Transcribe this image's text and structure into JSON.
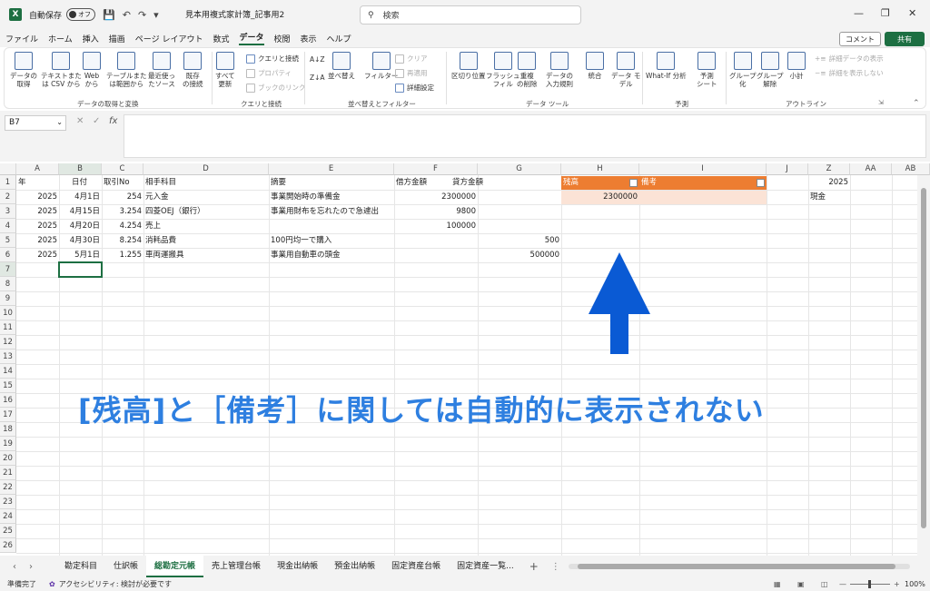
{
  "titlebar": {
    "autosave_label": "自動保存",
    "autosave_state": "オフ",
    "doc_title": "見本用複式家計簿_記事用2",
    "search_placeholder": "検索"
  },
  "menu": [
    "ファイル",
    "ホーム",
    "挿入",
    "描画",
    "ページ レイアウト",
    "数式",
    "データ",
    "校閲",
    "表示",
    "ヘルプ"
  ],
  "active_menu": "データ",
  "comment_label": "コメント",
  "share_label": "共有",
  "ribbon": {
    "get_data": "データの\n取得",
    "text_csv": "テキストまた\nは CSV から",
    "web": "Web\nから",
    "table_range": "テーブルまた\nは範囲から",
    "recent": "最近使っ\nたソース",
    "existing": "既存\nの接続",
    "group1": "データの取得と変換",
    "refresh_all": "すべて\n更新",
    "queries": "クエリと接続",
    "properties": "プロパティ",
    "book_links": "ブックのリンク",
    "group2": "クエリと接続",
    "sort": "並べ替え",
    "filter": "フィルター",
    "clear": "クリア",
    "reapply": "再適用",
    "advanced": "詳細設定",
    "group3": "並べ替えとフィルター",
    "text_to_col": "区切り位置",
    "flash_fill": "フラッシュ\nフィル",
    "remove_dup": "重複\nの削除",
    "validation": "データの\n入力規則",
    "consolidate": "統合",
    "data_model": "データ モ\nデル",
    "group4": "データ ツール",
    "whatif": "What-If 分析",
    "forecast": "予測\nシート",
    "group5": "予測",
    "group_btn": "グループ\n化",
    "ungroup": "グループ\n解除",
    "subtotal": "小計",
    "show_detail": "詳細データの表示",
    "hide_detail": "詳細を表示しない",
    "group6": "アウトライン"
  },
  "namebox": "B7",
  "fx": "fx",
  "columns": [
    "A",
    "B",
    "C",
    "D",
    "E",
    "F",
    "G",
    "H",
    "I",
    "J",
    "Z",
    "AA",
    "AB"
  ],
  "rows": [
    "1",
    "2",
    "3",
    "4",
    "5",
    "6",
    "7",
    "8",
    "9",
    "10",
    "11",
    "12",
    "13",
    "14",
    "15",
    "16",
    "17",
    "18",
    "19",
    "20",
    "21",
    "22",
    "23",
    "24",
    "25",
    "26"
  ],
  "headers": {
    "year": "年",
    "date": "日付",
    "txn_no": "取引No",
    "account": "相手科目",
    "summary": "摘要",
    "debit": "借方金額",
    "credit": "貸方金額",
    "balance": "残高",
    "note": "備考"
  },
  "table_rows": [
    {
      "year": "2025",
      "date": "4月1日",
      "no": "254",
      "account": "元入金",
      "summary": "事業開始時の準備金",
      "debit": "2300000",
      "credit": ""
    },
    {
      "year": "2025",
      "date": "4月15日",
      "no": "3.254",
      "account": "四菱OEJ（銀行）",
      "summary": "事業用財布を忘れたので急遽出",
      "debit": "9800",
      "credit": ""
    },
    {
      "year": "2025",
      "date": "4月20日",
      "no": "4.254",
      "account": "売上",
      "summary": "",
      "debit": "100000",
      "credit": ""
    },
    {
      "year": "2025",
      "date": "4月30日",
      "no": "8.254",
      "account": "消耗品費",
      "summary": "100円均一で購入",
      "debit": "",
      "credit": "500"
    },
    {
      "year": "2025",
      "date": "5月1日",
      "no": "1.255",
      "account": "車両運搬具",
      "summary": "事業用自動車の頭金",
      "debit": "",
      "credit": "500000"
    }
  ],
  "balance_value": "2300000",
  "z_year": "2025",
  "z_cash": "現金",
  "annotation": "[残高]と［備考］に関しては自動的に表示されない",
  "sheets": [
    "勘定科目",
    "仕訳帳",
    "総勘定元帳",
    "売上管理台帳",
    "現金出納帳",
    "預金出納帳",
    "固定資産台帳",
    "固定資産一覧..."
  ],
  "active_sheet": "総勘定元帳",
  "status": {
    "ready": "準備完了",
    "accessibility": "アクセシビリティ: 検討が必要です",
    "zoom": "100%"
  },
  "colors": {
    "excel_green": "#1d6f42",
    "header_orange": "#ed7d31",
    "row2_fill": "#fbe3d6",
    "annotation": "#2e7fe0",
    "arrow": "#0a5ad4"
  }
}
